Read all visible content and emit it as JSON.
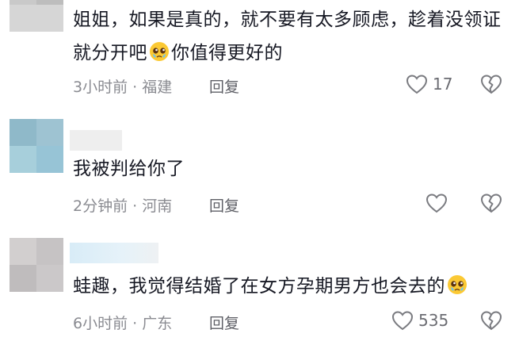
{
  "comments": [
    {
      "text_before_emoji": "姐姐，如果是真的，就不要有太多顾虑，趁着没领证就分开吧",
      "text_after_emoji": "你值得更好的",
      "emoji": "pleading-face-emoji",
      "time": "3小时前",
      "separator": "·",
      "location": "福建",
      "reply_label": "回复",
      "like_count": "17"
    },
    {
      "text_before_emoji": "我被判给你了",
      "text_after_emoji": "",
      "time": "2分钟前",
      "separator": "·",
      "location": "河南",
      "reply_label": "回复",
      "like_count": ""
    },
    {
      "text_before_emoji": "蛙趣，我觉得结婚了在女方孕期男方也会去的",
      "text_after_emoji": "",
      "emoji": "pleading-face-emoji",
      "time": "6小时前",
      "separator": "·",
      "location": "广东",
      "reply_label": "回复",
      "like_count": "535"
    }
  ],
  "icons": {
    "like": "heart-outline-icon",
    "dislike": "broken-heart-icon"
  },
  "colors": {
    "text": "#161823",
    "meta": "#8a8b91",
    "reply": "#5e5f66",
    "icon": "#7a7b80"
  }
}
